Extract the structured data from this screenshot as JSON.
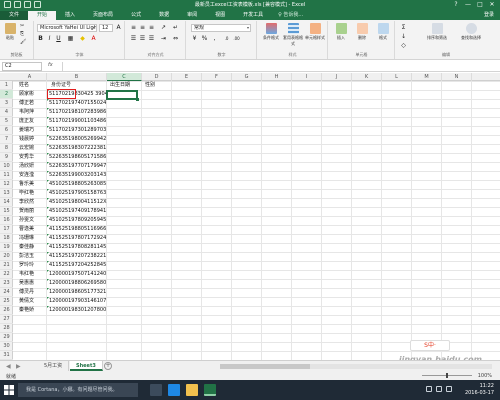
{
  "window": {
    "title": "最新员工excel工资表模板.xls [兼容模式] - Excel",
    "controls": [
      "?",
      "—",
      "□",
      "✕"
    ]
  },
  "ribbon_tabs": [
    "文件",
    "开始",
    "插入",
    "页面布局",
    "公式",
    "数据",
    "审阅",
    "视图",
    "开发工具"
  ],
  "tell_me": "♀ 告诉我...",
  "login": "登录",
  "ribbon": {
    "paste": "粘贴",
    "clipboard_label": "剪贴板",
    "font_name": "Microsoft YaHei UI Ligh",
    "font_size": "12",
    "font_label": "字体",
    "align_label": "对齐方式",
    "number_format": "常规",
    "number_label": "数字",
    "cond_format": "条件格式",
    "table_format": "套用表格格式",
    "cell_style": "单元格样式",
    "styles_label": "样式",
    "insert": "插入",
    "delete": "删除",
    "format": "格式",
    "cells_label": "单元格",
    "sort_filter": "排序和筛选",
    "find_select": "查找和选择",
    "edit_label": "编辑"
  },
  "formula_bar": {
    "name_box": "C2",
    "fx": "fx",
    "formula": ""
  },
  "columns": [
    "A",
    "B",
    "C",
    "D",
    "E",
    "F",
    "G",
    "H",
    "I",
    "J",
    "K",
    "L",
    "M",
    "N"
  ],
  "headers": {
    "a1": "姓名",
    "b1": "身份证号",
    "c1": "出生日期",
    "d1": "性别"
  },
  "rows": [
    [
      "顾家彬",
      "51170219830425 3904"
    ],
    [
      "傅正若",
      "511702197407155024"
    ],
    [
      "韦阿萍",
      "511702198107283986"
    ],
    [
      "庞正友",
      "511702199001103486"
    ],
    [
      "姜瑞巧",
      "511702197301289703"
    ],
    [
      "钱晨婷",
      "522635198005269942"
    ],
    [
      "云宏婉",
      "522635198307222381"
    ],
    [
      "安秀华",
      "522635198605171586"
    ],
    [
      "汤欣妍",
      "522635197707179947"
    ],
    [
      "安连滢",
      "522635199003203143"
    ],
    [
      "鲁乐美",
      "451025198805263085"
    ],
    [
      "毕红艳",
      "451025197905158763"
    ],
    [
      "李欣然",
      "45102519800411512X"
    ],
    [
      "贺雨丽",
      "451025197409178941"
    ],
    [
      "孙雯文",
      "451025197809205945"
    ],
    [
      "曹逸美",
      "411525198805116966"
    ],
    [
      "冯珊琳",
      "411525197807172924"
    ],
    [
      "秦佳静",
      "411525197808281145"
    ],
    [
      "彭洁玉",
      "411525197207238221"
    ],
    [
      "罗玲玲",
      "411525197204252845"
    ],
    [
      "韦红艳",
      "120000197507141240"
    ],
    [
      "吴惠惠",
      "120000198806269580"
    ],
    [
      "傅灵丹",
      "120000198605177321"
    ],
    [
      "黄倩文",
      "120000197903146107"
    ],
    [
      "秦艳娇",
      "120000198301207800"
    ]
  ],
  "row_numbers": [
    "1",
    "2",
    "3",
    "4",
    "5",
    "6",
    "7",
    "8",
    "9",
    "10",
    "11",
    "12",
    "13",
    "14",
    "15",
    "16",
    "17",
    "18",
    "19",
    "20",
    "21",
    "22",
    "23",
    "24",
    "25",
    "26",
    "27",
    "28",
    "29",
    "30",
    "31"
  ],
  "sheet_tabs": [
    "5月工资",
    "Sheet3"
  ],
  "status": {
    "ready": "就绪",
    "zoom": "100%"
  },
  "taskbar": {
    "search": "我是 Cortana，小娜。有问题尽管问我。",
    "time": "11:22",
    "date": "2016-03-17"
  },
  "watermark": "jingyan.baidu.com",
  "ime": "S中·"
}
